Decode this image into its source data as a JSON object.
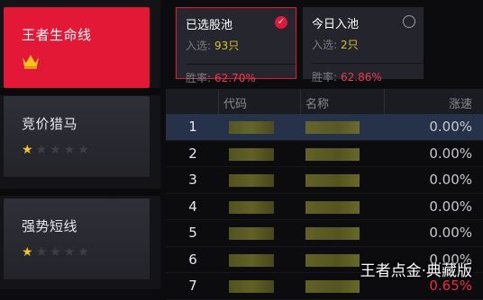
{
  "strategies": [
    {
      "name": "王者生命线",
      "rating": 5,
      "active": true
    },
    {
      "name": "竞价猎马",
      "rating": 1,
      "max": 5
    },
    {
      "name": "强势短线",
      "rating": 1,
      "max": 5
    }
  ],
  "pools": {
    "selected": {
      "title": "已选股池",
      "count_label": "入选:",
      "count": "93只",
      "rate_label": "胜率:",
      "rate": "62.70%"
    },
    "today": {
      "title": "今日入池",
      "count_label": "入选:",
      "count": "2只",
      "rate_label": "胜率:",
      "rate": "62.86%"
    }
  },
  "table": {
    "headers": {
      "code": "代码",
      "name": "名称",
      "change": "涨速"
    },
    "rows": [
      {
        "idx": "1",
        "change": "0.00%"
      },
      {
        "idx": "2",
        "change": "0.00%"
      },
      {
        "idx": "3",
        "change": "0.00%"
      },
      {
        "idx": "4",
        "change": "0.00%"
      },
      {
        "idx": "5",
        "change": "0.00%"
      },
      {
        "idx": "6",
        "change": "0.00%"
      },
      {
        "idx": "7",
        "change": "0.65%"
      }
    ]
  },
  "watermark": "王者点金·典藏版",
  "colors": {
    "accent_red": "#e31736",
    "rate_red": "#ee3b4e",
    "count_yellow": "#d9c12b",
    "star_gold": "#f5c518"
  }
}
